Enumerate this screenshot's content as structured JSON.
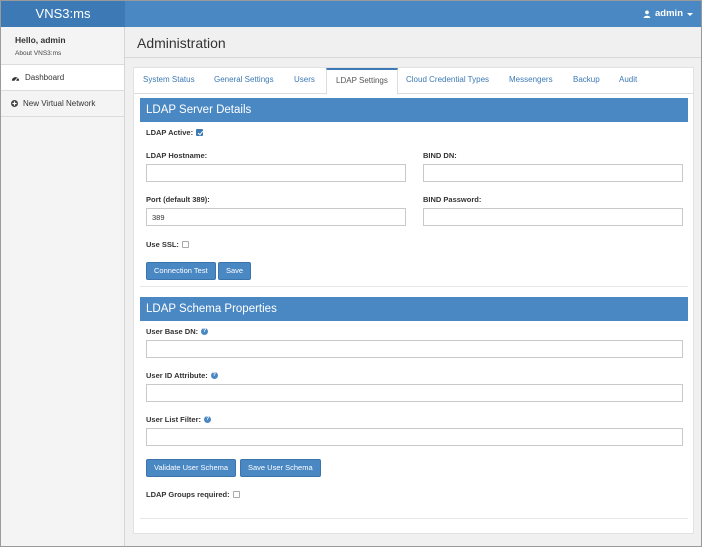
{
  "app": {
    "brand": "VNS3:ms",
    "user": "admin"
  },
  "sidebar": {
    "hello": "Hello, admin",
    "about": "About VNS3:ms",
    "items": [
      {
        "label": "Dashboard",
        "icon": "dashboard-icon"
      },
      {
        "label": "New Virtual Network",
        "icon": "plus-circle-icon"
      }
    ]
  },
  "page": {
    "title": "Administration"
  },
  "tabs": [
    {
      "label": "System Status"
    },
    {
      "label": "General Settings"
    },
    {
      "label": "Users"
    },
    {
      "label": "LDAP Settings",
      "active": true
    },
    {
      "label": "Cloud Credential Types"
    },
    {
      "label": "Messengers"
    },
    {
      "label": "Backup"
    },
    {
      "label": "Audit"
    }
  ],
  "ldap_server": {
    "heading": "LDAP Server Details",
    "active_label": "LDAP Active:",
    "active_checked": true,
    "hostname_label": "LDAP Hostname:",
    "hostname_value": "",
    "bind_dn_label": "BIND DN:",
    "bind_dn_value": "",
    "port_label": "Port (default 389):",
    "port_value": "389",
    "bind_password_label": "BIND Password:",
    "bind_password_value": "",
    "ssl_label": "Use SSL:",
    "ssl_checked": false,
    "connection_test_label": "Connection Test",
    "save_label": "Save"
  },
  "ldap_schema": {
    "heading": "LDAP Schema Properties",
    "user_base_dn_label": "User Base DN:",
    "user_base_dn_value": "",
    "user_id_attr_label": "User ID Attribute:",
    "user_id_attr_value": "",
    "user_list_filter_label": "User List Filter:",
    "user_list_filter_value": "",
    "validate_label": "Validate User Schema",
    "save_schema_label": "Save User Schema",
    "groups_required_label": "LDAP Groups required:",
    "groups_required_checked": false
  },
  "colors": {
    "primary": "#4a88c4",
    "brand_dark": "#3d7ab5"
  }
}
